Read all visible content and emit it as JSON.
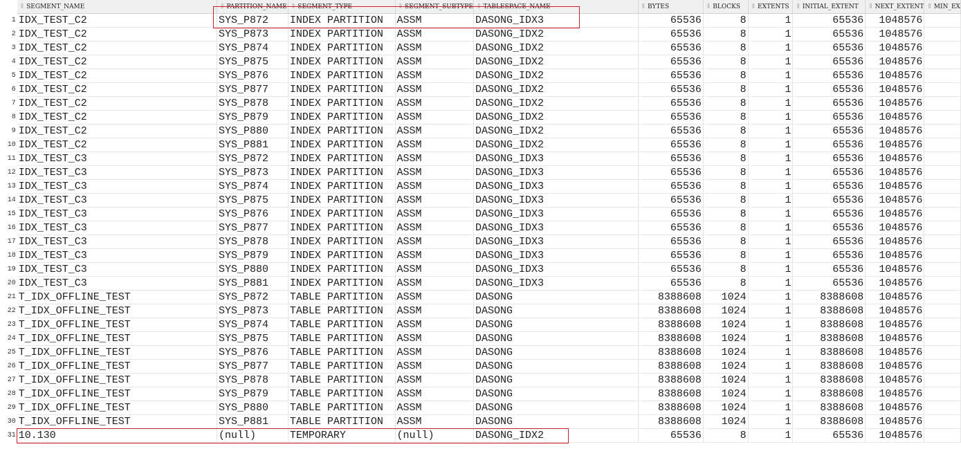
{
  "columns": [
    "SEGMENT_NAME",
    "PARTITION_NAME",
    "SEGMENT_TYPE",
    "SEGMENT_SUBTYPE",
    "TABLESPACE_NAME",
    "BYTES",
    "BLOCKS",
    "EXTENTS",
    "INITIAL_EXTENT",
    "NEXT_EXTENT",
    "MIN_EX"
  ],
  "rows": [
    [
      "IDX_TEST_C2",
      "SYS_P872",
      "INDEX PARTITION",
      "ASSM",
      "DASONG_IDX3",
      "65536",
      "8",
      "1",
      "65536",
      "1048576",
      ""
    ],
    [
      "IDX_TEST_C2",
      "SYS_P873",
      "INDEX PARTITION",
      "ASSM",
      "DASONG_IDX2",
      "65536",
      "8",
      "1",
      "65536",
      "1048576",
      ""
    ],
    [
      "IDX_TEST_C2",
      "SYS_P874",
      "INDEX PARTITION",
      "ASSM",
      "DASONG_IDX2",
      "65536",
      "8",
      "1",
      "65536",
      "1048576",
      ""
    ],
    [
      "IDX_TEST_C2",
      "SYS_P875",
      "INDEX PARTITION",
      "ASSM",
      "DASONG_IDX2",
      "65536",
      "8",
      "1",
      "65536",
      "1048576",
      ""
    ],
    [
      "IDX_TEST_C2",
      "SYS_P876",
      "INDEX PARTITION",
      "ASSM",
      "DASONG_IDX2",
      "65536",
      "8",
      "1",
      "65536",
      "1048576",
      ""
    ],
    [
      "IDX_TEST_C2",
      "SYS_P877",
      "INDEX PARTITION",
      "ASSM",
      "DASONG_IDX2",
      "65536",
      "8",
      "1",
      "65536",
      "1048576",
      ""
    ],
    [
      "IDX_TEST_C2",
      "SYS_P878",
      "INDEX PARTITION",
      "ASSM",
      "DASONG_IDX2",
      "65536",
      "8",
      "1",
      "65536",
      "1048576",
      ""
    ],
    [
      "IDX_TEST_C2",
      "SYS_P879",
      "INDEX PARTITION",
      "ASSM",
      "DASONG_IDX2",
      "65536",
      "8",
      "1",
      "65536",
      "1048576",
      ""
    ],
    [
      "IDX_TEST_C2",
      "SYS_P880",
      "INDEX PARTITION",
      "ASSM",
      "DASONG_IDX2",
      "65536",
      "8",
      "1",
      "65536",
      "1048576",
      ""
    ],
    [
      "IDX_TEST_C2",
      "SYS_P881",
      "INDEX PARTITION",
      "ASSM",
      "DASONG_IDX2",
      "65536",
      "8",
      "1",
      "65536",
      "1048576",
      ""
    ],
    [
      "IDX_TEST_C3",
      "SYS_P872",
      "INDEX PARTITION",
      "ASSM",
      "DASONG_IDX3",
      "65536",
      "8",
      "1",
      "65536",
      "1048576",
      ""
    ],
    [
      "IDX_TEST_C3",
      "SYS_P873",
      "INDEX PARTITION",
      "ASSM",
      "DASONG_IDX3",
      "65536",
      "8",
      "1",
      "65536",
      "1048576",
      ""
    ],
    [
      "IDX_TEST_C3",
      "SYS_P874",
      "INDEX PARTITION",
      "ASSM",
      "DASONG_IDX3",
      "65536",
      "8",
      "1",
      "65536",
      "1048576",
      ""
    ],
    [
      "IDX_TEST_C3",
      "SYS_P875",
      "INDEX PARTITION",
      "ASSM",
      "DASONG_IDX3",
      "65536",
      "8",
      "1",
      "65536",
      "1048576",
      ""
    ],
    [
      "IDX_TEST_C3",
      "SYS_P876",
      "INDEX PARTITION",
      "ASSM",
      "DASONG_IDX3",
      "65536",
      "8",
      "1",
      "65536",
      "1048576",
      ""
    ],
    [
      "IDX_TEST_C3",
      "SYS_P877",
      "INDEX PARTITION",
      "ASSM",
      "DASONG_IDX3",
      "65536",
      "8",
      "1",
      "65536",
      "1048576",
      ""
    ],
    [
      "IDX_TEST_C3",
      "SYS_P878",
      "INDEX PARTITION",
      "ASSM",
      "DASONG_IDX3",
      "65536",
      "8",
      "1",
      "65536",
      "1048576",
      ""
    ],
    [
      "IDX_TEST_C3",
      "SYS_P879",
      "INDEX PARTITION",
      "ASSM",
      "DASONG_IDX3",
      "65536",
      "8",
      "1",
      "65536",
      "1048576",
      ""
    ],
    [
      "IDX_TEST_C3",
      "SYS_P880",
      "INDEX PARTITION",
      "ASSM",
      "DASONG_IDX3",
      "65536",
      "8",
      "1",
      "65536",
      "1048576",
      ""
    ],
    [
      "IDX_TEST_C3",
      "SYS_P881",
      "INDEX PARTITION",
      "ASSM",
      "DASONG_IDX3",
      "65536",
      "8",
      "1",
      "65536",
      "1048576",
      ""
    ],
    [
      "T_IDX_OFFLINE_TEST",
      "SYS_P872",
      "TABLE PARTITION",
      "ASSM",
      "DASONG",
      "8388608",
      "1024",
      "1",
      "8388608",
      "1048576",
      ""
    ],
    [
      "T_IDX_OFFLINE_TEST",
      "SYS_P873",
      "TABLE PARTITION",
      "ASSM",
      "DASONG",
      "8388608",
      "1024",
      "1",
      "8388608",
      "1048576",
      ""
    ],
    [
      "T_IDX_OFFLINE_TEST",
      "SYS_P874",
      "TABLE PARTITION",
      "ASSM",
      "DASONG",
      "8388608",
      "1024",
      "1",
      "8388608",
      "1048576",
      ""
    ],
    [
      "T_IDX_OFFLINE_TEST",
      "SYS_P875",
      "TABLE PARTITION",
      "ASSM",
      "DASONG",
      "8388608",
      "1024",
      "1",
      "8388608",
      "1048576",
      ""
    ],
    [
      "T_IDX_OFFLINE_TEST",
      "SYS_P876",
      "TABLE PARTITION",
      "ASSM",
      "DASONG",
      "8388608",
      "1024",
      "1",
      "8388608",
      "1048576",
      ""
    ],
    [
      "T_IDX_OFFLINE_TEST",
      "SYS_P877",
      "TABLE PARTITION",
      "ASSM",
      "DASONG",
      "8388608",
      "1024",
      "1",
      "8388608",
      "1048576",
      ""
    ],
    [
      "T_IDX_OFFLINE_TEST",
      "SYS_P878",
      "TABLE PARTITION",
      "ASSM",
      "DASONG",
      "8388608",
      "1024",
      "1",
      "8388608",
      "1048576",
      ""
    ],
    [
      "T_IDX_OFFLINE_TEST",
      "SYS_P879",
      "TABLE PARTITION",
      "ASSM",
      "DASONG",
      "8388608",
      "1024",
      "1",
      "8388608",
      "1048576",
      ""
    ],
    [
      "T_IDX_OFFLINE_TEST",
      "SYS_P880",
      "TABLE PARTITION",
      "ASSM",
      "DASONG",
      "8388608",
      "1024",
      "1",
      "8388608",
      "1048576",
      ""
    ],
    [
      "T_IDX_OFFLINE_TEST",
      "SYS_P881",
      "TABLE PARTITION",
      "ASSM",
      "DASONG",
      "8388608",
      "1024",
      "1",
      "8388608",
      "1048576",
      ""
    ],
    [
      "10.130",
      "(null)",
      "TEMPORARY",
      "(null)",
      "DASONG_IDX2",
      "65536",
      "8",
      "1",
      "65536",
      "1048576",
      ""
    ]
  ],
  "highlight_color": "#c8202a"
}
